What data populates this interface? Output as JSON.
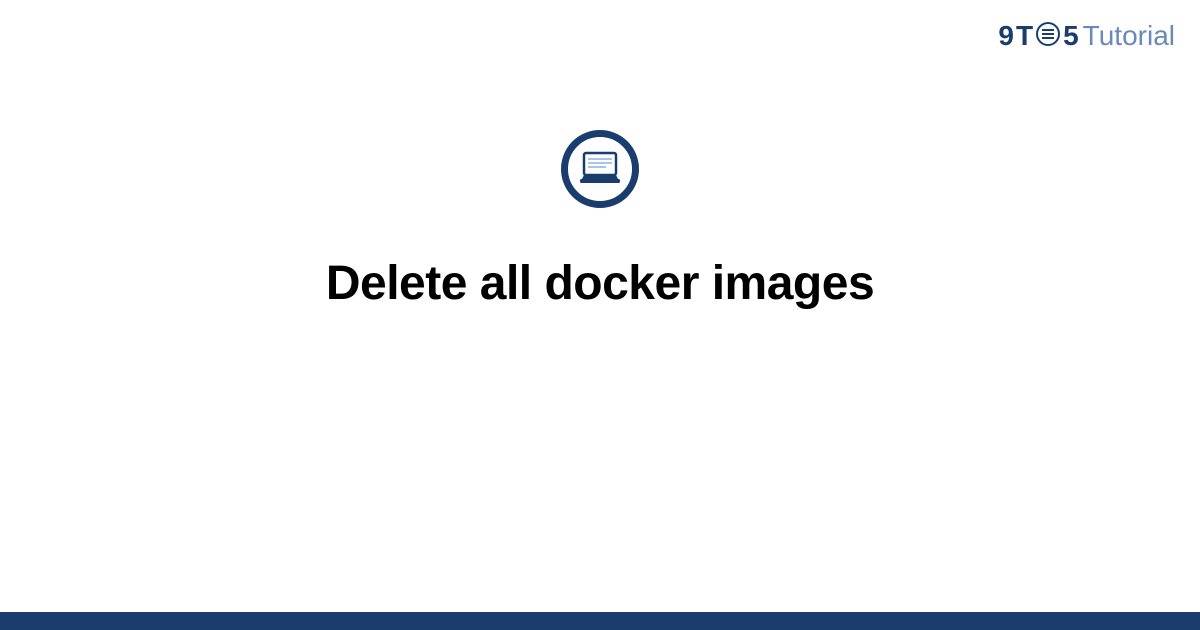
{
  "brand": {
    "nine": "9",
    "t": "T",
    "five": "5",
    "tutorial": "Tutorial"
  },
  "page": {
    "title": "Delete all docker images"
  },
  "colors": {
    "primary": "#1a3d6d",
    "secondary": "#6b89b8",
    "icon_light": "#a8c5e8"
  }
}
